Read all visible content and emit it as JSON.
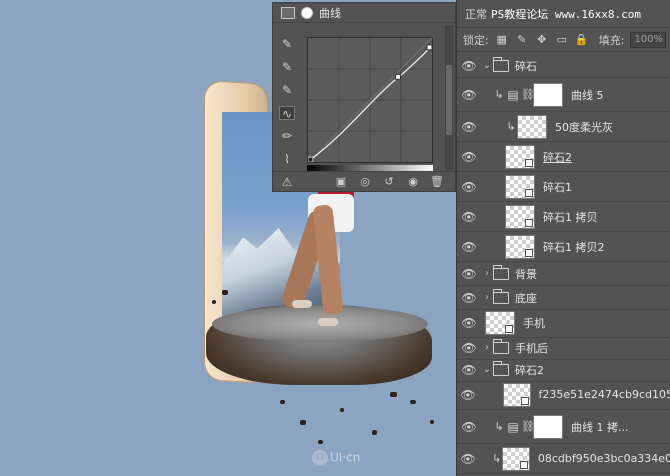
{
  "properties": {
    "title": "曲线",
    "tools": [
      "eyedropper-black-icon",
      "eyedropper-gray-icon",
      "eyedropper-white-icon",
      "curve-edit-icon",
      "pencil-icon",
      "smooth-icon",
      "warning-icon"
    ]
  },
  "layers_panel": {
    "blend_mode": "正常",
    "site_watermark": "PS教程论坛 www.16xx8.com",
    "lock_label": "锁定:",
    "fill_label": "填充:",
    "fill_value": "100%",
    "layers": [
      {
        "type": "group",
        "name": "碎石",
        "open": true
      },
      {
        "type": "adjustment",
        "name": "曲线 5"
      },
      {
        "type": "layer",
        "name": "50度柔光灰"
      },
      {
        "type": "smart",
        "name": "碎石2"
      },
      {
        "type": "smart",
        "name": "碎石1"
      },
      {
        "type": "smart",
        "name": "碎石1 拷贝"
      },
      {
        "type": "smart",
        "name": "碎石1 拷贝2"
      },
      {
        "type": "group",
        "name": "背景",
        "open": false
      },
      {
        "type": "group",
        "name": "底座",
        "open": false
      },
      {
        "type": "smart",
        "name": "手机"
      },
      {
        "type": "group",
        "name": "手机后",
        "open": false
      },
      {
        "type": "group",
        "name": "碎石2",
        "open": true
      },
      {
        "type": "smart",
        "name": "f235e51e2474cb9cd105..."
      },
      {
        "type": "adjustment",
        "name": "曲线 1 拷..."
      },
      {
        "type": "smart",
        "name": "08cdbf950e3bc0a334e0..."
      }
    ]
  },
  "canvas": {
    "watermark": "UI·cn"
  },
  "colors": {
    "canvas_bg": "#8ba4c2",
    "panel_bg": "#535353"
  }
}
